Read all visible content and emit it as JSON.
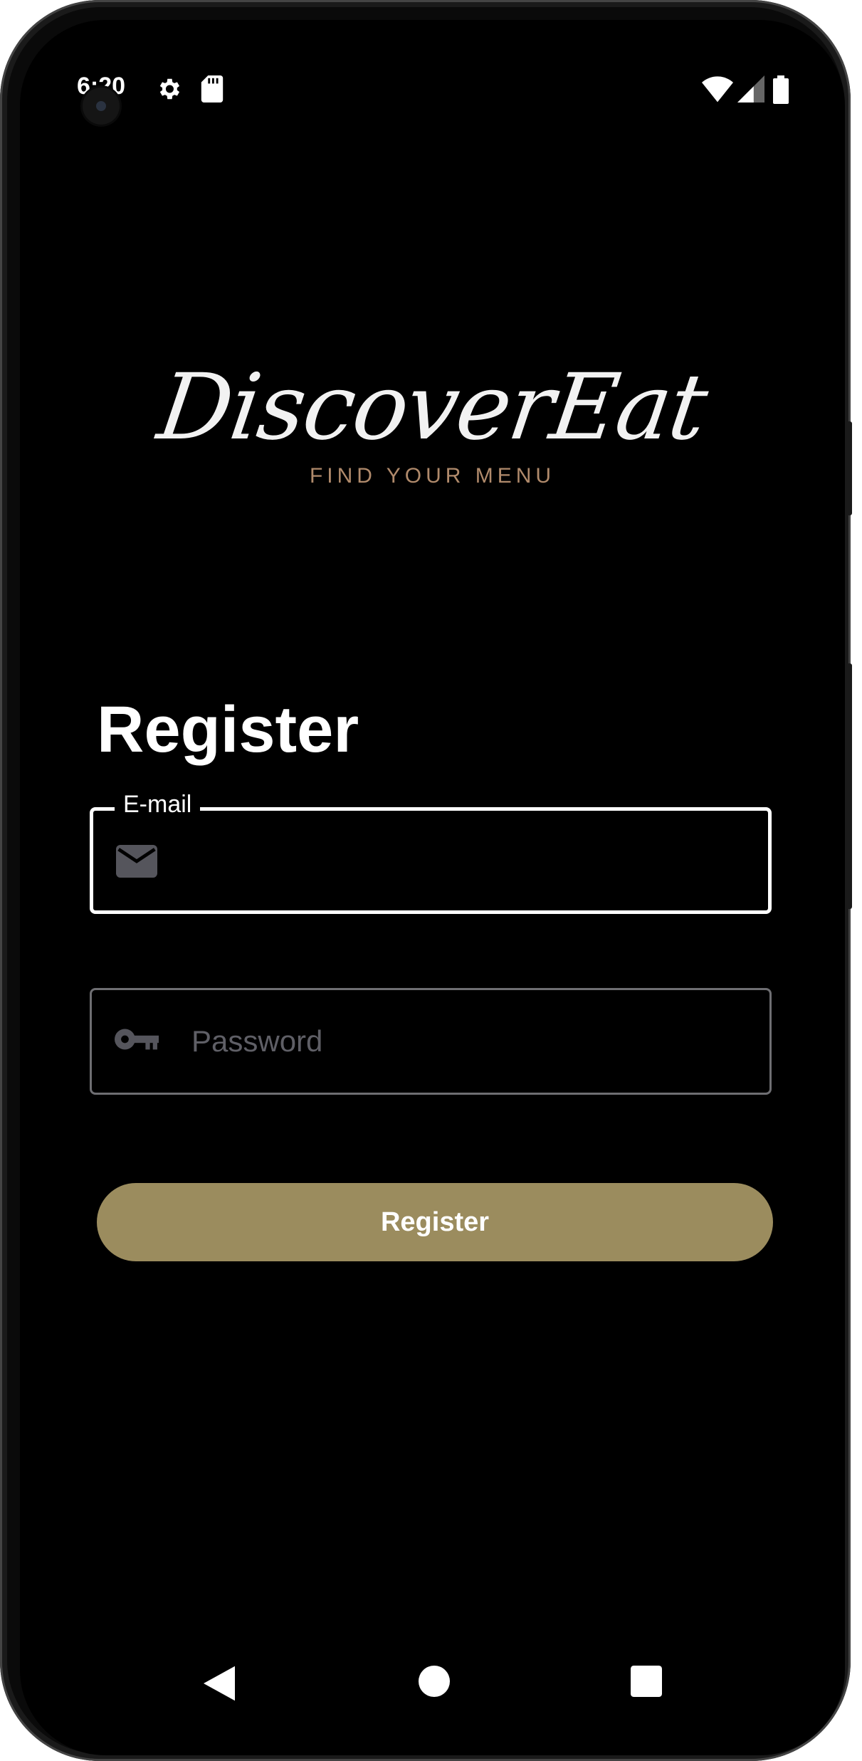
{
  "status_bar": {
    "time": "6:20",
    "icons": [
      "settings-icon",
      "sd-card-icon",
      "wifi-icon",
      "cell-signal-icon",
      "battery-icon"
    ]
  },
  "logo": {
    "name": "DiscoverEat",
    "tagline": "FIND YOUR MENU"
  },
  "form": {
    "title": "Register",
    "email": {
      "label": "E-mail",
      "value": "",
      "icon": "email-icon"
    },
    "password": {
      "placeholder": "Password",
      "value": "",
      "icon": "key-icon"
    },
    "submit_label": "Register"
  },
  "nav_bar": {
    "items": [
      "back-icon",
      "home-icon",
      "recents-icon"
    ]
  },
  "colors": {
    "background": "#000000",
    "button": "#9b8c5e",
    "tagline": "#b08a6b",
    "field_border_active": "#ffffff",
    "field_border_idle": "#6e6e72",
    "icon_muted": "#55555c"
  }
}
